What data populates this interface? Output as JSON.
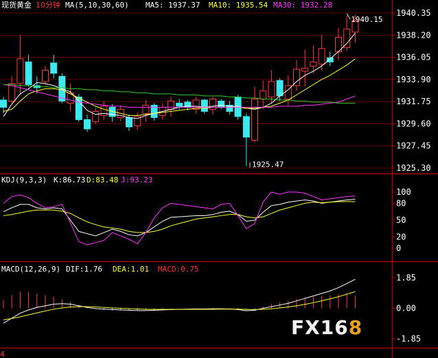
{
  "colors": {
    "background": "#000000",
    "border": "#c00000",
    "up": "#ff3b3b",
    "down": "#3ee8ee",
    "ma5": "#ffffff",
    "ma10": "#ffff33",
    "ma30": "#ff33ff",
    "ma60": "#33cc33",
    "axis_text": "#ffffff"
  },
  "header": {
    "instrument": "现货黄金",
    "period": "10分钟",
    "ma_label": "MA(5,10,30,60)",
    "ma5": "MA5: 1937.37",
    "ma10": "MA10: 1935.54",
    "ma30": "MA30: 1932.28"
  },
  "watermark": {
    "part1": "FX16",
    "part2": "8"
  },
  "corner_label": "4",
  "chart_data": [
    {
      "type": "candlestick",
      "title": "现货黄金 10分钟",
      "ylim": [
        1925.3,
        1940.35
      ],
      "y_ticks": [
        "1940.35",
        "1938.20",
        "1936.05",
        "1933.90",
        "1931.75",
        "1929.60",
        "1927.45",
        "1925.30"
      ],
      "annotations": [
        {
          "text": "1940.15",
          "x": 41,
          "y": 1940.15
        },
        {
          "text": "1925.47",
          "x": 30,
          "y": 1925.47
        }
      ],
      "candles": [
        [
          1931.9,
          1931.2,
          1930.6,
          1932.2
        ],
        [
          1931.8,
          1933.5,
          1931.6,
          1934.2
        ],
        [
          1933.5,
          1935.9,
          1932.4,
          1938.2
        ],
        [
          1935.6,
          1933.4,
          1933.2,
          1936.3
        ],
        [
          1933.3,
          1933.1,
          1932.5,
          1934.2
        ],
        [
          1933.7,
          1934.8,
          1933.4,
          1935.2
        ],
        [
          1935.5,
          1934.5,
          1934.0,
          1936.3
        ],
        [
          1934.2,
          1931.8,
          1931.6,
          1934.5
        ],
        [
          1931.6,
          1932.6,
          1930.8,
          1933.5
        ],
        [
          1932.2,
          1930.0,
          1929.8,
          1932.5
        ],
        [
          1930.0,
          1929.1,
          1928.8,
          1930.5
        ],
        [
          1929.8,
          1930.8,
          1929.6,
          1931.2
        ],
        [
          1930.4,
          1931.3,
          1930.0,
          1931.8
        ],
        [
          1931.2,
          1930.3,
          1929.8,
          1931.5
        ],
        [
          1930.2,
          1931.0,
          1929.8,
          1931.4
        ],
        [
          1930.2,
          1929.3,
          1928.9,
          1930.5
        ],
        [
          1929.4,
          1930.3,
          1929.0,
          1930.7
        ],
        [
          1930.6,
          1931.4,
          1929.8,
          1931.9
        ],
        [
          1931.4,
          1930.2,
          1929.9,
          1931.6
        ],
        [
          1930.4,
          1931.2,
          1930.0,
          1931.6
        ],
        [
          1931.0,
          1931.8,
          1930.3,
          1932.2
        ],
        [
          1931.6,
          1931.3,
          1931.0,
          1932.0
        ],
        [
          1931.7,
          1931.2,
          1930.9,
          1931.9
        ],
        [
          1931.0,
          1931.9,
          1930.6,
          1932.2
        ],
        [
          1931.9,
          1930.8,
          1930.6,
          1932.0
        ],
        [
          1931.0,
          1932.0,
          1930.5,
          1932.2
        ],
        [
          1931.8,
          1931.2,
          1931.0,
          1932.0
        ],
        [
          1931.4,
          1930.8,
          1930.5,
          1931.8
        ],
        [
          1932.2,
          1930.3,
          1930.0,
          1932.4
        ],
        [
          1930.3,
          1928.3,
          1925.5,
          1930.6
        ],
        [
          1928.0,
          1932.0,
          1927.8,
          1933.2
        ],
        [
          1932.0,
          1932.8,
          1931.0,
          1933.8
        ],
        [
          1932.2,
          1933.7,
          1931.6,
          1934.8
        ],
        [
          1933.8,
          1932.3,
          1931.8,
          1934.0
        ],
        [
          1932.0,
          1933.3,
          1931.4,
          1934.3
        ],
        [
          1933.3,
          1934.9,
          1932.8,
          1935.8
        ],
        [
          1934.7,
          1935.0,
          1933.2,
          1936.8
        ],
        [
          1935.2,
          1935.6,
          1934.5,
          1937.2
        ],
        [
          1935.4,
          1936.9,
          1934.8,
          1938.2
        ],
        [
          1936.0,
          1935.6,
          1935.2,
          1936.6
        ],
        [
          1936.6,
          1938.0,
          1935.8,
          1938.9
        ],
        [
          1937.0,
          1938.8,
          1936.7,
          1940.1
        ],
        [
          1938.5,
          1939.6,
          1937.5,
          1940.2
        ]
      ],
      "series": [
        {
          "name": "MA5",
          "values": [
            1930.3,
            1931.5,
            1932.5,
            1933.0,
            1933.6,
            1933.5,
            1933.3,
            1933.0,
            1932.7,
            1931.8,
            1930.9,
            1930.5,
            1930.6,
            1930.5,
            1930.4,
            1930.2,
            1930.1,
            1930.4,
            1930.6,
            1930.8,
            1931.0,
            1931.2,
            1931.3,
            1931.3,
            1931.2,
            1931.3,
            1931.4,
            1931.3,
            1931.3,
            1931.1,
            1931.0,
            1931.2,
            1931.6,
            1932.3,
            1932.9,
            1933.7,
            1934.3,
            1934.7,
            1935.2,
            1935.9,
            1936.6,
            1937.4,
            1938.4
          ]
        },
        {
          "name": "MA10",
          "values": [
            1930.8,
            1931.0,
            1931.8,
            1932.5,
            1932.8,
            1933.0,
            1933.0,
            1932.9,
            1932.5,
            1932.1,
            1931.7,
            1931.3,
            1931.0,
            1930.8,
            1930.6,
            1930.4,
            1930.4,
            1930.5,
            1930.6,
            1930.7,
            1930.8,
            1930.9,
            1931.0,
            1931.1,
            1931.1,
            1931.2,
            1931.2,
            1931.2,
            1931.2,
            1931.1,
            1931.1,
            1931.2,
            1931.3,
            1931.6,
            1931.9,
            1932.4,
            1932.9,
            1933.4,
            1933.9,
            1934.3,
            1934.8,
            1935.3,
            1935.9
          ]
        },
        {
          "name": "MA30",
          "values": [
            1933.4,
            1933.3,
            1933.1,
            1932.9,
            1932.7,
            1932.5,
            1932.3,
            1932.1,
            1931.9,
            1931.7,
            1931.6,
            1931.5,
            1931.4,
            1931.3,
            1931.3,
            1931.2,
            1931.2,
            1931.2,
            1931.2,
            1931.2,
            1931.2,
            1931.2,
            1931.2,
            1931.2,
            1931.2,
            1931.2,
            1931.2,
            1931.2,
            1931.2,
            1931.2,
            1931.2,
            1931.2,
            1931.2,
            1931.3,
            1931.3,
            1931.3,
            1931.4,
            1931.4,
            1931.5,
            1931.6,
            1931.7,
            1932.0,
            1932.3
          ]
        },
        {
          "name": "MA60",
          "values": [
            1933.4,
            1933.4,
            1933.3,
            1933.3,
            1933.2,
            1933.2,
            1933.1,
            1933.1,
            1933.0,
            1933.0,
            1932.9,
            1932.9,
            1932.8,
            1932.8,
            1932.7,
            1932.7,
            1932.6,
            1932.6,
            1932.5,
            1932.5,
            1932.5,
            1932.4,
            1932.4,
            1932.4,
            1932.3,
            1932.3,
            1932.3,
            1932.2,
            1932.2,
            1932.1,
            1932.1,
            1932.0,
            1932.0,
            1931.9,
            1931.9,
            1931.8,
            1931.8,
            1931.7,
            1931.7,
            1931.7,
            1931.6,
            1931.6,
            1931.6
          ]
        }
      ]
    },
    {
      "type": "line",
      "title": "KDJ(9,3,3)",
      "readout": {
        "k": "K:86.73",
        "d": "D:83.48",
        "j": "J:93.23"
      },
      "ylim": [
        0,
        100
      ],
      "y_ticks": [
        "100",
        "80",
        "50",
        "20",
        "0"
      ],
      "series": [
        {
          "name": "K",
          "values": [
            65,
            72,
            78,
            78,
            72,
            70,
            72,
            70,
            50,
            30,
            26,
            22,
            28,
            34,
            30,
            24,
            22,
            28,
            38,
            48,
            55,
            56,
            57,
            58,
            58,
            60,
            64,
            66,
            60,
            48,
            50,
            64,
            76,
            78,
            82,
            84,
            86,
            84,
            80,
            82,
            84,
            86,
            87
          ]
        },
        {
          "name": "D",
          "values": [
            58,
            60,
            63,
            66,
            68,
            68,
            68,
            66,
            62,
            54,
            47,
            42,
            38,
            36,
            34,
            30,
            28,
            28,
            30,
            34,
            40,
            44,
            48,
            52,
            54,
            56,
            58,
            60,
            60,
            56,
            54,
            56,
            62,
            68,
            72,
            76,
            80,
            82,
            81,
            82,
            83,
            83,
            83
          ]
        },
        {
          "name": "J",
          "values": [
            80,
            92,
            95,
            90,
            80,
            72,
            74,
            78,
            45,
            12,
            6,
            10,
            14,
            28,
            22,
            16,
            8,
            28,
            54,
            72,
            80,
            78,
            76,
            74,
            72,
            70,
            78,
            80,
            58,
            35,
            44,
            82,
            100,
            96,
            100,
            100,
            98,
            92,
            86,
            88,
            90,
            92,
            93
          ]
        }
      ]
    },
    {
      "type": "line",
      "title": "MACD(12,26,9)",
      "readout": {
        "dif": "DIF:1.76",
        "dea": "DEA:1.01",
        "macd": "MACD:0.75"
      },
      "ylim": [
        -1.85,
        1.85
      ],
      "y_ticks": [
        "1.85",
        "0.00",
        "-1.85"
      ],
      "series": [
        {
          "name": "DIF",
          "values": [
            -0.9,
            -0.6,
            -0.3,
            -0.1,
            0.05,
            0.15,
            0.25,
            0.28,
            0.25,
            0.15,
            0.05,
            -0.02,
            -0.05,
            -0.08,
            -0.1,
            -0.12,
            -0.14,
            -0.14,
            -0.12,
            -0.1,
            -0.08,
            -0.06,
            -0.05,
            -0.04,
            -0.04,
            -0.03,
            -0.03,
            -0.04,
            -0.08,
            -0.15,
            -0.12,
            0.0,
            0.1,
            0.2,
            0.3,
            0.45,
            0.6,
            0.75,
            0.9,
            1.05,
            1.25,
            1.5,
            1.76
          ]
        },
        {
          "name": "DEA",
          "values": [
            -0.7,
            -0.62,
            -0.52,
            -0.4,
            -0.28,
            -0.16,
            -0.06,
            0.02,
            0.08,
            0.1,
            0.1,
            0.08,
            0.05,
            0.02,
            0.0,
            -0.02,
            -0.04,
            -0.06,
            -0.07,
            -0.07,
            -0.07,
            -0.07,
            -0.07,
            -0.06,
            -0.06,
            -0.06,
            -0.05,
            -0.05,
            -0.05,
            -0.07,
            -0.08,
            -0.06,
            -0.03,
            0.02,
            0.08,
            0.15,
            0.24,
            0.34,
            0.45,
            0.57,
            0.7,
            0.85,
            1.01
          ]
        },
        {
          "name": "MACD",
          "values": [
            0.5,
            0.8,
            1.0,
            1.0,
            0.9,
            0.8,
            0.7,
            0.55,
            0.4,
            0.2,
            0.05,
            -0.05,
            -0.1,
            -0.12,
            -0.12,
            -0.12,
            -0.12,
            -0.1,
            -0.08,
            -0.06,
            -0.03,
            -0.01,
            0.02,
            0.03,
            0.03,
            0.04,
            0.04,
            0.02,
            -0.05,
            -0.1,
            -0.08,
            0.1,
            0.25,
            0.35,
            0.45,
            0.55,
            0.65,
            0.7,
            0.75,
            0.8,
            0.85,
            0.95,
            0.75
          ]
        }
      ]
    }
  ]
}
